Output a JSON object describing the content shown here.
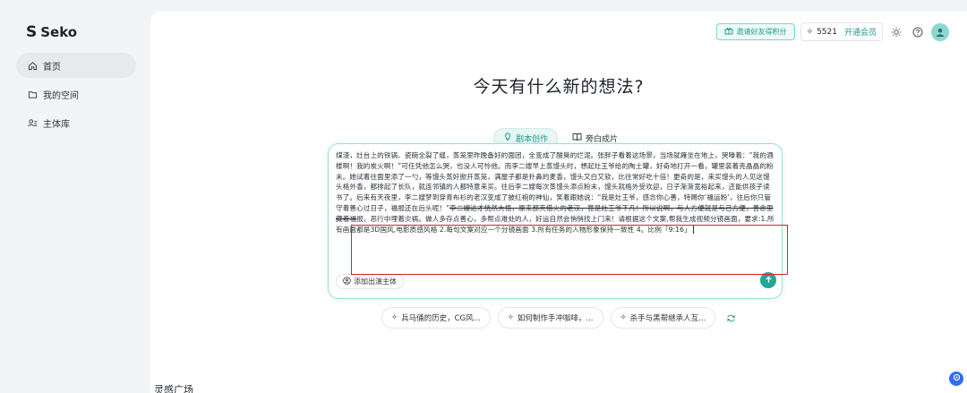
{
  "brand": {
    "name": "Seko",
    "mark": "S"
  },
  "sidebar": {
    "items": [
      {
        "label": "首页",
        "icon": "home-icon"
      },
      {
        "label": "我的空间",
        "icon": "folder-icon"
      },
      {
        "label": "主体库",
        "icon": "people-list-icon"
      }
    ]
  },
  "topbar": {
    "invite_label": "邀请好友得积分",
    "credits": "5521",
    "vip_label": "开通会员"
  },
  "title": "今天有什么新的想法?",
  "modes": [
    {
      "label": "剧本创作",
      "active": true
    },
    {
      "label": "旁白成片",
      "active": false
    }
  ],
  "editor": {
    "text_before": "煤渣，灶台上的铁锅、瓷碗全裂了缝，蒸笼里昨晚备好的面团，全变成了酸臭的烂泥。张胖子看着这场景，当场就瘫坐在地上，哭嚎着：“我的酒楼啊！我的炭火啊！”可任凭他怎么哭，也没人可怜他。而李二嫂早上蒸馒头时，想起灶王爷给的陶土罐，好奇地打开一看，罐里装着亮晶晶的粉末。她试着往面里添了一勺，等馒头蒸好掀开蒸笼，满屋子都是扑鼻的麦香，馒头又白又软，比往常好吃十倍！更奇的是，来买馒头的人见这馒头格外香，都排起了长队，就连邻镇的人都特意来买。往后李二嫂每次蒸馒头添点粉末，馒头就格外受欢迎，日子渐渐宽裕起来，还能供孩子读书了。后来有天夜里，李二嫂梦到穿青布衫的老汉变成了披红袍的神仙，笑着跟她说：“我是灶王爷，感念你心善，特赐你‘福运粉’，往后你只管守着善心过日子，福报还在后头呢！”",
    "text_struck": "李二嫂这才恍然大悟，原来那天借火的老汉，竟是灶王爷下凡！所以说啊，与人方便就是与己方便，善念里藏着福",
    "text_after": "报，恶行中埋着灾祸。做人多存点善心，多帮点难处的人，好运自然会悄悄找上门来！请根据这个文案,帮我生成视频分镜画面，要求:1.所有画面都是3D国风,电影质感风格 2.每句文案对应一个分镜画面 3.所有任务的人物形象保持一致性 4。比例「9:16」",
    "add_subject_label": "添加出演主体"
  },
  "suggestions": [
    "兵马俑的历史，CG风...",
    "如何制作手冲咖啡，...",
    "杀手与黑帮继承人互..."
  ],
  "section_title": "灵感广场",
  "colors": {
    "accent": "#1a9a8c",
    "send_button": "#1fa896",
    "annotation_box": "#e02020",
    "float_button": "#2f6df6"
  }
}
